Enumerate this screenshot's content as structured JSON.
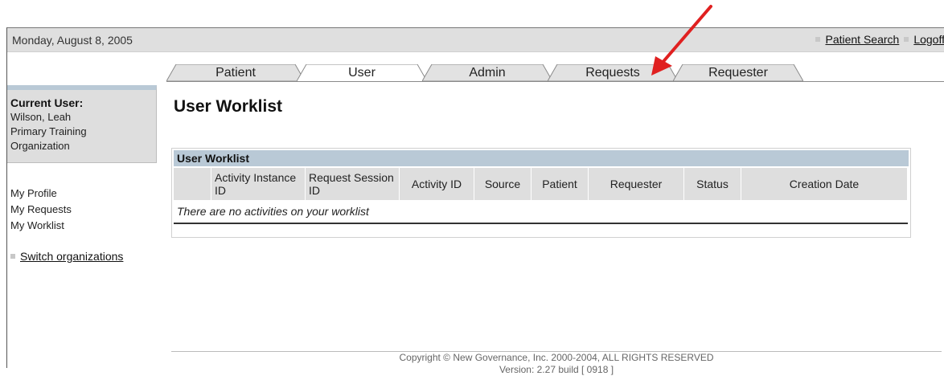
{
  "header": {
    "date": "Monday, August 8, 2005",
    "links": [
      "Patient Search",
      "Logoff"
    ]
  },
  "tabs": [
    {
      "label": "Patient",
      "active": false
    },
    {
      "label": "User",
      "active": true
    },
    {
      "label": "Admin",
      "active": false
    },
    {
      "label": "Requests",
      "active": false
    },
    {
      "label": "Requester",
      "active": false
    }
  ],
  "sidebar": {
    "current_user_label": "Current User:",
    "user_name": "Wilson, Leah",
    "org_line1": "Primary Training",
    "org_line2": "Organization",
    "links": [
      "My Profile",
      "My Requests",
      "My Worklist"
    ],
    "switch_label": "Switch organizations"
  },
  "main": {
    "title": "User Worklist",
    "panel_title": "User Worklist",
    "columns": [
      "",
      "Activity Instance ID",
      "Request Session ID",
      "Activity ID",
      "Source",
      "Patient",
      "Requester",
      "Status",
      "Creation Date"
    ],
    "empty_message": "There are no activities on your worklist"
  },
  "footer": {
    "copyright": "Copyright © New Governance, Inc. 2000-2004, ALL RIGHTS RESERVED",
    "version": "Version: 2.27 build [ 0918 ]"
  },
  "colors": {
    "annotation_arrow": "#e02020",
    "panel_header": "#b9c9d6",
    "topbar": "#dfdfdf"
  }
}
